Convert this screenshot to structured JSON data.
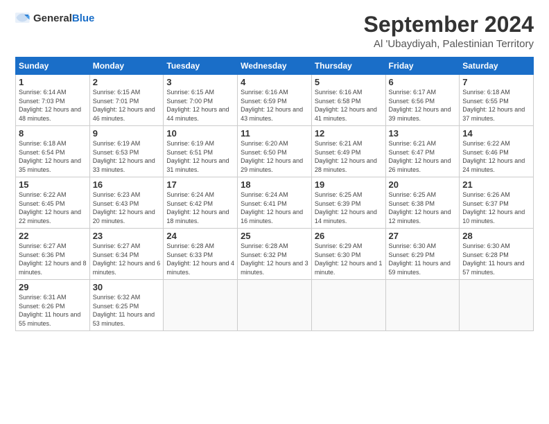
{
  "header": {
    "logo_general": "General",
    "logo_blue": "Blue",
    "title": "September 2024",
    "subtitle": "Al 'Ubaydiyah, Palestinian Territory"
  },
  "days_of_week": [
    "Sunday",
    "Monday",
    "Tuesday",
    "Wednesday",
    "Thursday",
    "Friday",
    "Saturday"
  ],
  "weeks": [
    [
      {
        "day": "1",
        "sunrise": "6:14 AM",
        "sunset": "7:03 PM",
        "daylight": "12 hours and 48 minutes."
      },
      {
        "day": "2",
        "sunrise": "6:15 AM",
        "sunset": "7:01 PM",
        "daylight": "12 hours and 46 minutes."
      },
      {
        "day": "3",
        "sunrise": "6:15 AM",
        "sunset": "7:00 PM",
        "daylight": "12 hours and 44 minutes."
      },
      {
        "day": "4",
        "sunrise": "6:16 AM",
        "sunset": "6:59 PM",
        "daylight": "12 hours and 43 minutes."
      },
      {
        "day": "5",
        "sunrise": "6:16 AM",
        "sunset": "6:58 PM",
        "daylight": "12 hours and 41 minutes."
      },
      {
        "day": "6",
        "sunrise": "6:17 AM",
        "sunset": "6:56 PM",
        "daylight": "12 hours and 39 minutes."
      },
      {
        "day": "7",
        "sunrise": "6:18 AM",
        "sunset": "6:55 PM",
        "daylight": "12 hours and 37 minutes."
      }
    ],
    [
      {
        "day": "8",
        "sunrise": "6:18 AM",
        "sunset": "6:54 PM",
        "daylight": "12 hours and 35 minutes."
      },
      {
        "day": "9",
        "sunrise": "6:19 AM",
        "sunset": "6:53 PM",
        "daylight": "12 hours and 33 minutes."
      },
      {
        "day": "10",
        "sunrise": "6:19 AM",
        "sunset": "6:51 PM",
        "daylight": "12 hours and 31 minutes."
      },
      {
        "day": "11",
        "sunrise": "6:20 AM",
        "sunset": "6:50 PM",
        "daylight": "12 hours and 29 minutes."
      },
      {
        "day": "12",
        "sunrise": "6:21 AM",
        "sunset": "6:49 PM",
        "daylight": "12 hours and 28 minutes."
      },
      {
        "day": "13",
        "sunrise": "6:21 AM",
        "sunset": "6:47 PM",
        "daylight": "12 hours and 26 minutes."
      },
      {
        "day": "14",
        "sunrise": "6:22 AM",
        "sunset": "6:46 PM",
        "daylight": "12 hours and 24 minutes."
      }
    ],
    [
      {
        "day": "15",
        "sunrise": "6:22 AM",
        "sunset": "6:45 PM",
        "daylight": "12 hours and 22 minutes."
      },
      {
        "day": "16",
        "sunrise": "6:23 AM",
        "sunset": "6:43 PM",
        "daylight": "12 hours and 20 minutes."
      },
      {
        "day": "17",
        "sunrise": "6:24 AM",
        "sunset": "6:42 PM",
        "daylight": "12 hours and 18 minutes."
      },
      {
        "day": "18",
        "sunrise": "6:24 AM",
        "sunset": "6:41 PM",
        "daylight": "12 hours and 16 minutes."
      },
      {
        "day": "19",
        "sunrise": "6:25 AM",
        "sunset": "6:39 PM",
        "daylight": "12 hours and 14 minutes."
      },
      {
        "day": "20",
        "sunrise": "6:25 AM",
        "sunset": "6:38 PM",
        "daylight": "12 hours and 12 minutes."
      },
      {
        "day": "21",
        "sunrise": "6:26 AM",
        "sunset": "6:37 PM",
        "daylight": "12 hours and 10 minutes."
      }
    ],
    [
      {
        "day": "22",
        "sunrise": "6:27 AM",
        "sunset": "6:36 PM",
        "daylight": "12 hours and 8 minutes."
      },
      {
        "day": "23",
        "sunrise": "6:27 AM",
        "sunset": "6:34 PM",
        "daylight": "12 hours and 6 minutes."
      },
      {
        "day": "24",
        "sunrise": "6:28 AM",
        "sunset": "6:33 PM",
        "daylight": "12 hours and 4 minutes."
      },
      {
        "day": "25",
        "sunrise": "6:28 AM",
        "sunset": "6:32 PM",
        "daylight": "12 hours and 3 minutes."
      },
      {
        "day": "26",
        "sunrise": "6:29 AM",
        "sunset": "6:30 PM",
        "daylight": "12 hours and 1 minute."
      },
      {
        "day": "27",
        "sunrise": "6:30 AM",
        "sunset": "6:29 PM",
        "daylight": "11 hours and 59 minutes."
      },
      {
        "day": "28",
        "sunrise": "6:30 AM",
        "sunset": "6:28 PM",
        "daylight": "11 hours and 57 minutes."
      }
    ],
    [
      {
        "day": "29",
        "sunrise": "6:31 AM",
        "sunset": "6:26 PM",
        "daylight": "11 hours and 55 minutes."
      },
      {
        "day": "30",
        "sunrise": "6:32 AM",
        "sunset": "6:25 PM",
        "daylight": "11 hours and 53 minutes."
      },
      null,
      null,
      null,
      null,
      null
    ]
  ]
}
